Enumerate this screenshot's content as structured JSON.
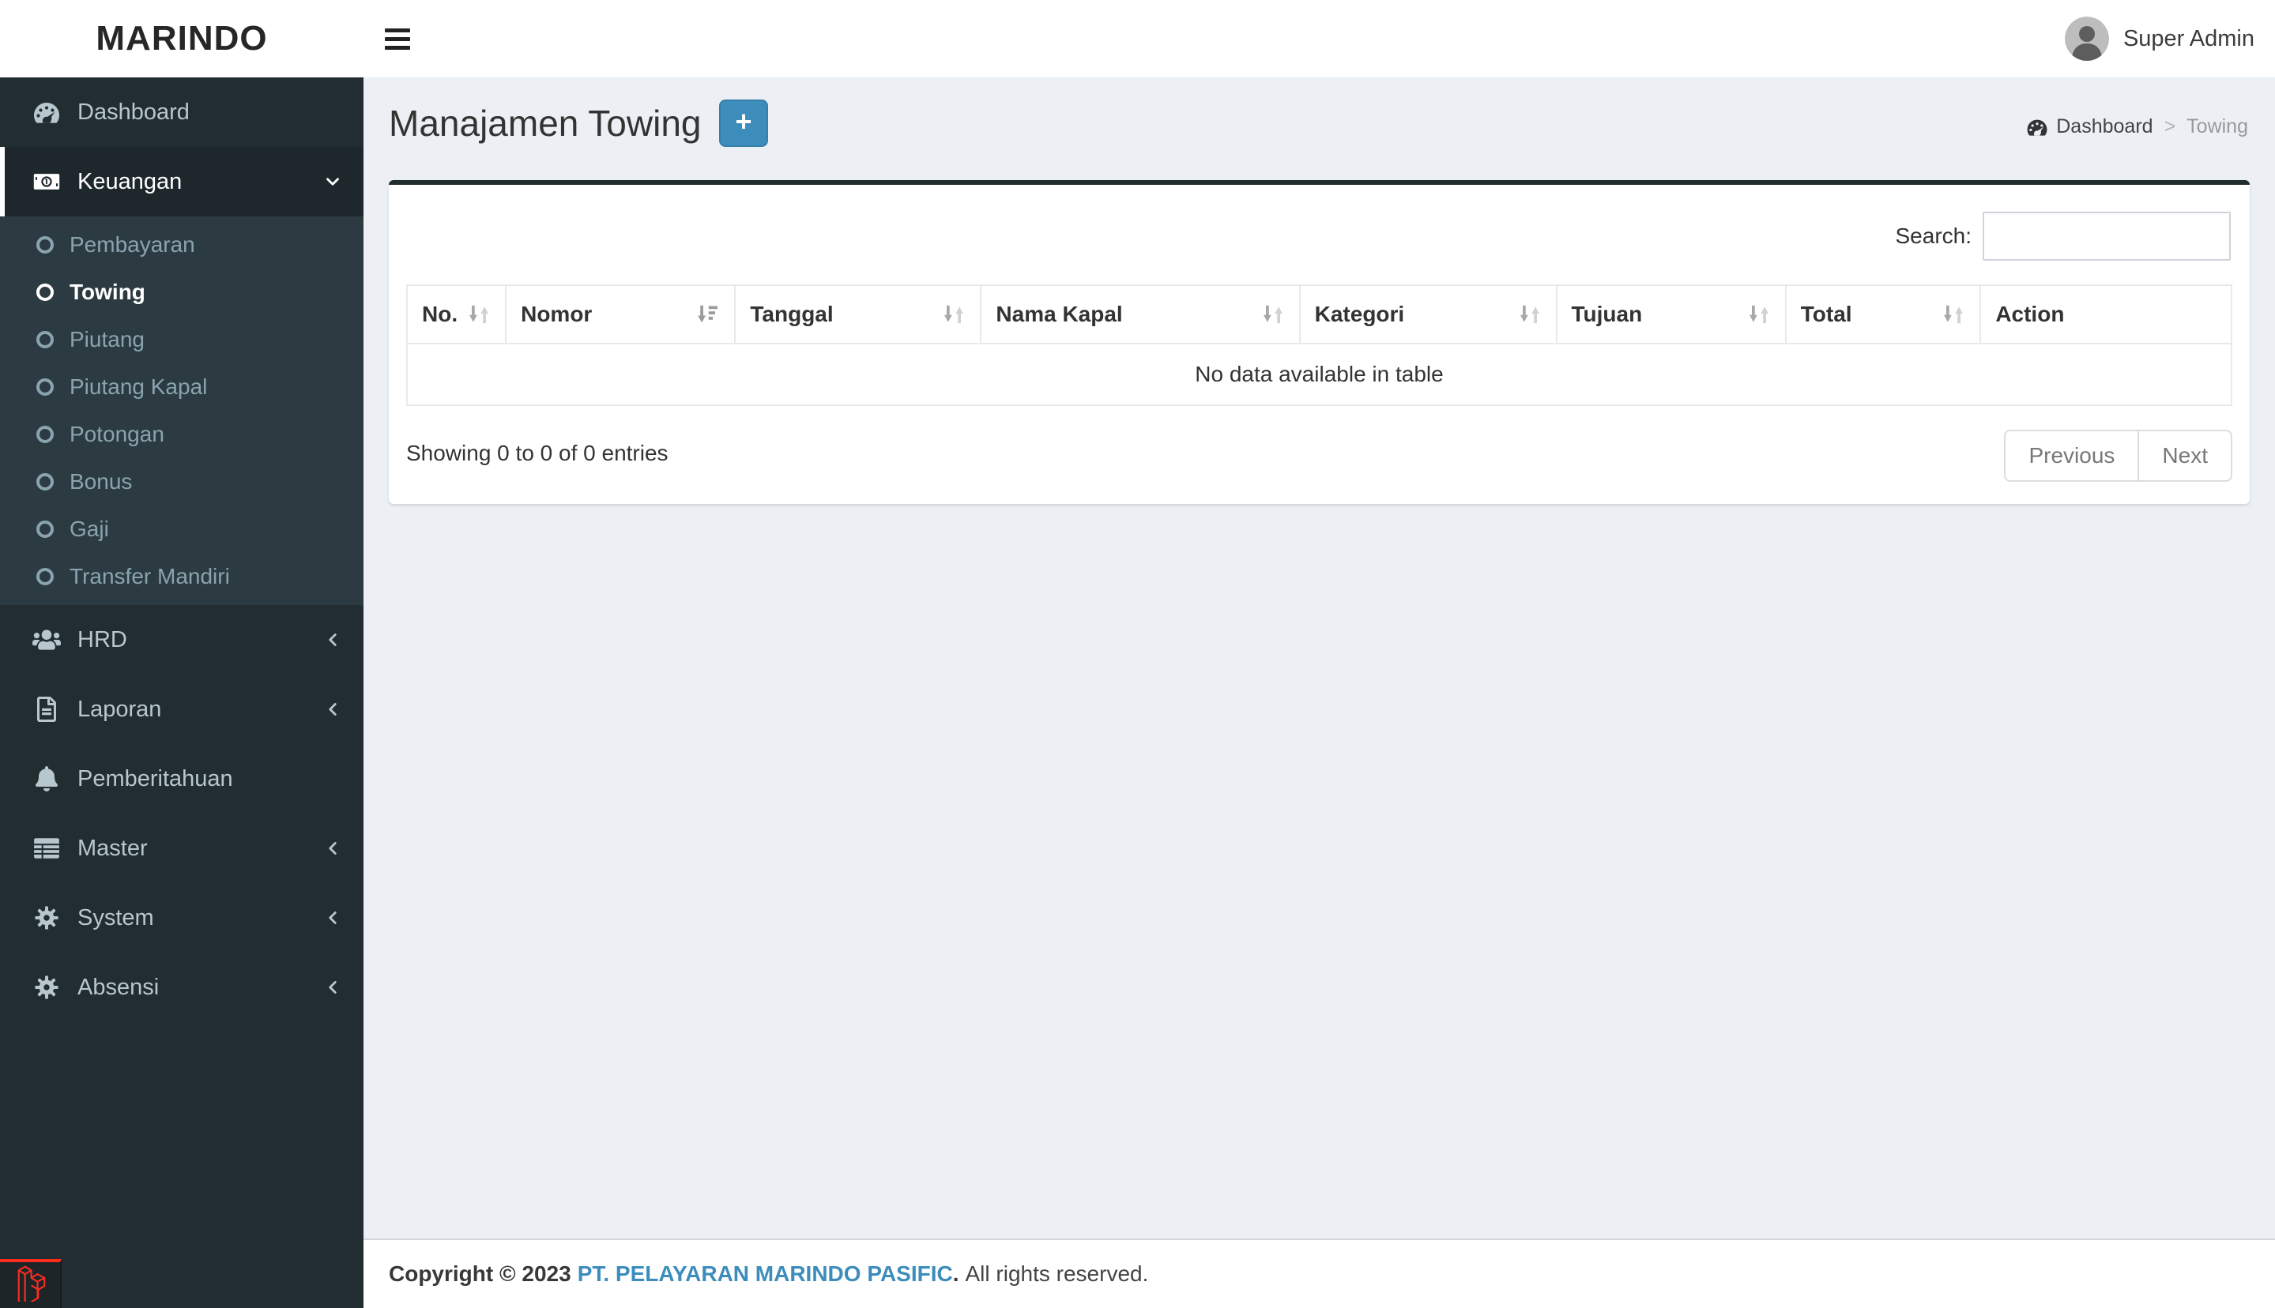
{
  "app": {
    "brand": "MARINDO"
  },
  "header": {
    "user_name": "Super Admin"
  },
  "sidebar": {
    "items": [
      {
        "label": "Dashboard",
        "icon": "gauge-icon"
      },
      {
        "label": "Keuangan",
        "icon": "money-bill-icon",
        "active": true,
        "chevron": "down",
        "submenu": [
          {
            "label": "Pembayaran"
          },
          {
            "label": "Towing",
            "active": true
          },
          {
            "label": "Piutang"
          },
          {
            "label": "Piutang Kapal"
          },
          {
            "label": "Potongan"
          },
          {
            "label": "Bonus"
          },
          {
            "label": "Gaji"
          },
          {
            "label": "Transfer Mandiri"
          }
        ]
      },
      {
        "label": "HRD",
        "icon": "users-icon",
        "chevron": "left"
      },
      {
        "label": "Laporan",
        "icon": "file-icon",
        "chevron": "left"
      },
      {
        "label": "Pemberitahuan",
        "icon": "bell-icon"
      },
      {
        "label": "Master",
        "icon": "table-icon",
        "chevron": "left"
      },
      {
        "label": "System",
        "icon": "gear-icon",
        "chevron": "left"
      },
      {
        "label": "Absensi",
        "icon": "gear-icon",
        "chevron": "left"
      }
    ]
  },
  "page": {
    "title": "Manajamen Towing",
    "add_button_label": "+"
  },
  "breadcrumb": {
    "home": "Dashboard",
    "separator": ">",
    "current": "Towing"
  },
  "panel": {
    "search_label": "Search:",
    "search_value": ""
  },
  "table": {
    "columns": [
      {
        "label": "No.",
        "sort": "both"
      },
      {
        "label": "Nomor",
        "sort": "desc"
      },
      {
        "label": "Tanggal",
        "sort": "both"
      },
      {
        "label": "Nama Kapal",
        "sort": "both"
      },
      {
        "label": "Kategori",
        "sort": "both"
      },
      {
        "label": "Tujuan",
        "sort": "both"
      },
      {
        "label": "Total",
        "sort": "both"
      },
      {
        "label": "Action",
        "sort": "none"
      }
    ],
    "empty_text": "No data available in table",
    "info": "Showing 0 to 0 of 0 entries",
    "pagination": {
      "previous": "Previous",
      "next": "Next"
    }
  },
  "footer": {
    "copyright": "Copyright © 2023",
    "company": "PT. PELAYARAN MARINDO PASIFIC",
    "company_suffix": ".",
    "rights": "All rights reserved."
  },
  "colors": {
    "accent_blue": "#3c8dbc",
    "accent_blue_border": "#367fa9",
    "sidebar_bg": "#222d32",
    "sidebar_active_bg": "#1e282c",
    "submenu_bg": "#2c3b41",
    "sidebar_text": "#b8c7ce",
    "submenu_text": "#8aa4af",
    "content_bg": "#ecf0f5",
    "laravel_red": "#ff2d20"
  }
}
